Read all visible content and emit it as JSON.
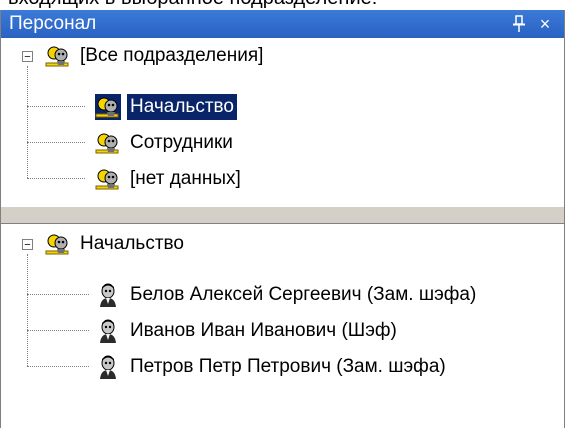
{
  "caption": "входящих в выбранное подразделение:",
  "panel": {
    "title": "Персонал",
    "pin_glyph": "ᵠ",
    "close_glyph": "×"
  },
  "departments_tree": {
    "root": {
      "label": "[Все подразделения]",
      "expander": "−",
      "icon": "group-icon"
    },
    "children": [
      {
        "label": "Начальство",
        "selected": true,
        "icon": "group-icon"
      },
      {
        "label": "Сотрудники",
        "selected": false,
        "icon": "group-icon"
      },
      {
        "label": "[нет данных]",
        "selected": false,
        "icon": "group-icon"
      }
    ]
  },
  "staff_tree": {
    "root": {
      "label": "Начальство",
      "expander": "−",
      "icon": "group-icon"
    },
    "children": [
      {
        "label": "Белов Алексей Сергеевич (Зам. шэфа)",
        "icon": "person-icon"
      },
      {
        "label": "Иванов Иван Иванович (Шэф)",
        "icon": "person-icon"
      },
      {
        "label": "Петров Петр Петрович (Зам. шэфа)",
        "icon": "person-icon"
      }
    ]
  },
  "colors": {
    "titlebar": "#2a62c2",
    "selection": "#0a246a",
    "icon_yellow": "#f5d400",
    "splitter": "#d4d0c8"
  }
}
